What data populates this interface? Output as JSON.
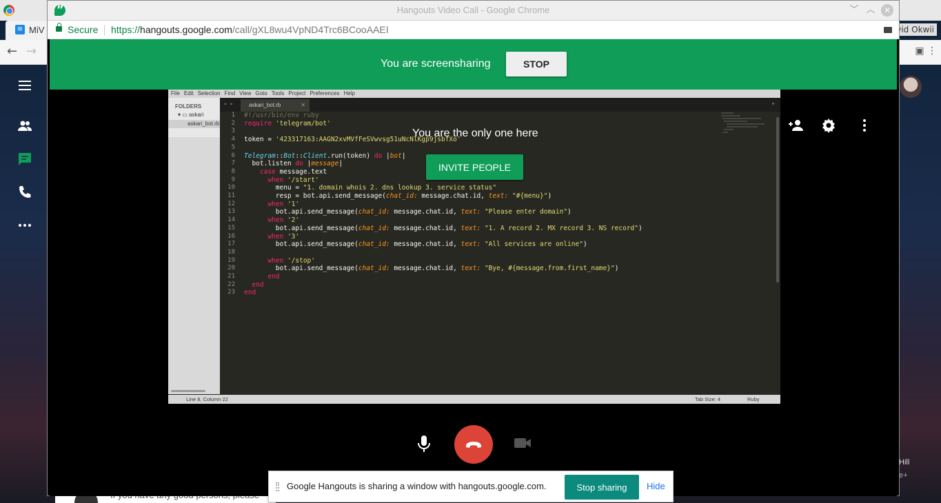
{
  "background": {
    "tab_label": "MiV",
    "tab_icon": "wifi-icon",
    "user_name": "vid Okwii",
    "right_text": "Hill",
    "right_sub": "e+",
    "bottom_text": "If you have any good persons, please"
  },
  "window": {
    "title": "Hangouts Video Call - Google Chrome"
  },
  "address_bar": {
    "secure_label": "Secure",
    "url_scheme": "https://",
    "url_host": "hangouts.google.com",
    "url_path": "/call/gXL8wu4VpND4Trc6BCooAAEI"
  },
  "banner": {
    "text": "You are screensharing",
    "stop_label": "STOP"
  },
  "call": {
    "only_one_text": "You are the only one here",
    "invite_label": "INVITE PEOPLE",
    "hangup_color": "#db4437"
  },
  "editor": {
    "menu": [
      "File",
      "Edit",
      "Selection",
      "Find",
      "View",
      "Goto",
      "Tools",
      "Project",
      "Preferences",
      "Help"
    ],
    "folders_label": "FOLDERS",
    "folder_name": "askari",
    "file_name": "askari_bot.rb",
    "tab_name": "askari_bot.rb",
    "status_position": "Line 8, Column 22",
    "status_tab_size": "Tab Size: 4",
    "status_syntax": "Ruby",
    "line_count": 23
  },
  "share_bar": {
    "message": "Google Hangouts is sharing a window with hangouts.google.com.",
    "stop_label": "Stop sharing",
    "hide_label": "Hide"
  },
  "colors": {
    "brand_green": "#0f9d58",
    "stop_sharing_teal": "#0b8a7d",
    "editor_bg": "#272822"
  }
}
